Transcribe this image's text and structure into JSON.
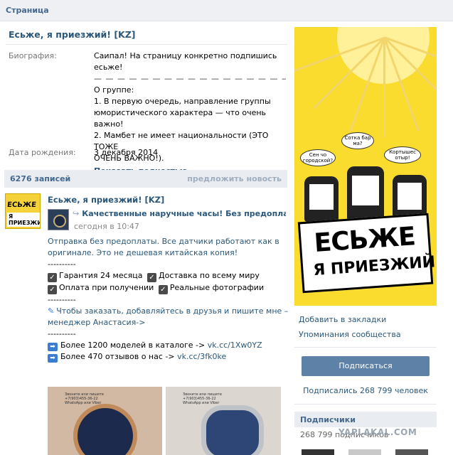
{
  "topbar": {
    "title": "Страница"
  },
  "page": {
    "name": "Есьже, я приезжий! [KZ]"
  },
  "info": {
    "bio_label": "Биография:",
    "bio_lines": [
      "Саипал! На страницу конкретно подпишись есьже!",
      "— — — — — — — — — — — — — — — — — — — —",
      "О группе:",
      "1. В первую очередь, направление группы",
      "юмористического характера — что очень важно!",
      "2. Мамбет не имеет национальности (ЭТО ТОЖЕ",
      "ОЧЕНЬ ВАЖНО!)."
    ],
    "show_full": "Показать полностью..",
    "birth_label": "Дата рождения:",
    "birth_value": "3 декабря 2014"
  },
  "wall": {
    "count": "6276 записей",
    "suggest": "предложить новость"
  },
  "post": {
    "author": "Есьже, я приезжий! [KZ]",
    "avatar_text1": "ЕСЬЖЕ",
    "avatar_text2": "Я ПРИЕЗЖИЙ",
    "repost_title": "Качественные наручные часы! Без предоплаты",
    "repost_date": "сегодня в 10:47",
    "line1": "Отправка без предоплаты. Все датчики работают как в",
    "line2": "оригинале. Это не дешевая китайская копия!",
    "dashes": "----------",
    "check1": "Гарантия 24 месяца",
    "check2": "Доставка по всему миру",
    "check3": "Оплата при получении",
    "check4": "Реальные фотографии",
    "order1": "Чтобы заказать, добавляйтесь в друзья и пишите мне –",
    "order2": "менеджер Анастасия->",
    "cat_text": "Более 1200 моделей в каталоге ->",
    "cat_link": "vk.cc/1Xw0YZ",
    "rev_text": "Более 470 отзывов о нас ->",
    "rev_link": "vk.cc/3fk0ke",
    "photo_caption": "Звоните или пишите\n+7(903)455-36-22\nWhatsApp или Viber"
  },
  "poster": {
    "bubble1": "Сен чо городской?",
    "bubble2": "Сотка бар ма?",
    "bubble3": "Кортышес отыр!",
    "line1": "ЕСЬЖЕ",
    "line2": "Я ПРИЕЗЖИЙ !"
  },
  "sidebar": {
    "bookmark": "Добавить в закладки",
    "mentions": "Упоминания сообщества",
    "join": "Подписаться",
    "subs_count": "Подписались 268 799 человек",
    "subs_title": "Подписчики",
    "subs_line": "268 799 подписчиков",
    "watermark": "YAPLAKAL.COM"
  },
  "colors": {
    "link": "#2b587a",
    "header_bg": "#e9edf1",
    "button": "#5e81a8",
    "poster_yellow": "#fadc2e"
  }
}
